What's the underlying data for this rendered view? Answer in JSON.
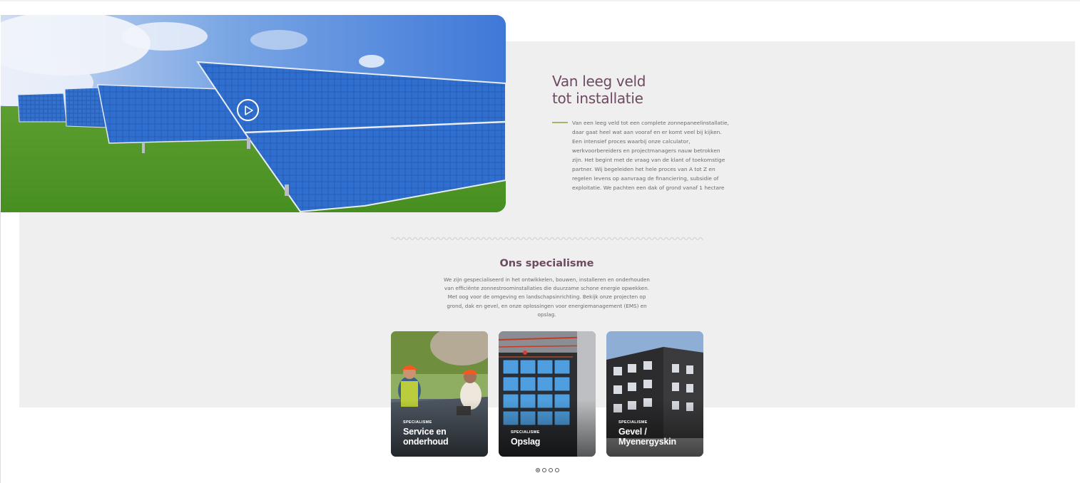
{
  "intro": {
    "title_line1": "Van leeg veld",
    "title_line2": "tot installatie",
    "body": "Van een leeg veld tot een complete zonnepaneelinstallatie, daar gaat heel wat aan vooraf en er komt veel bij kijken. Een intensief proces waarbij onze calculator, werkvoorbereiders en projectmanagers nauw betrokken zijn. Het begint met de vraag van de klant of toekomstige partner. Wij begeleiden het hele proces van A tot Z en regelen levens op aanvraag de financiering, subsidie of exploitatie. We pachten een dak of grond vanaf 1 hectare"
  },
  "hero": {
    "play_icon": "play-circle-icon"
  },
  "specialism": {
    "title": "Ons specialisme",
    "body": "We zijn gespecialiseerd in het ontwikkelen, bouwen, installeren en onderhouden van efficiënte zonnestroominstallaties die duurzame schone energie opwekken. Met oog voor de omgeving en landschapsinrichting. Bekijk onze projecten op grond, dak en gevel, en onze oplossingen voor energiemanagement (EMS) en opslag.",
    "cards": [
      {
        "kicker": "SPECIALISME",
        "name_line1": "Service en",
        "name_line2": "onderhoud"
      },
      {
        "kicker": "SPECIALISME",
        "name_line1": "Opslag",
        "name_line2": ""
      },
      {
        "kicker": "SPECIALISME",
        "name_line1": "Gevel /",
        "name_line2": "Myenergyskin"
      }
    ]
  },
  "carousel": {
    "pages": 4,
    "active": 1
  },
  "colors": {
    "heading": "#6d4a61",
    "accent_rule": "#a7b36a",
    "band": "#efefef"
  }
}
